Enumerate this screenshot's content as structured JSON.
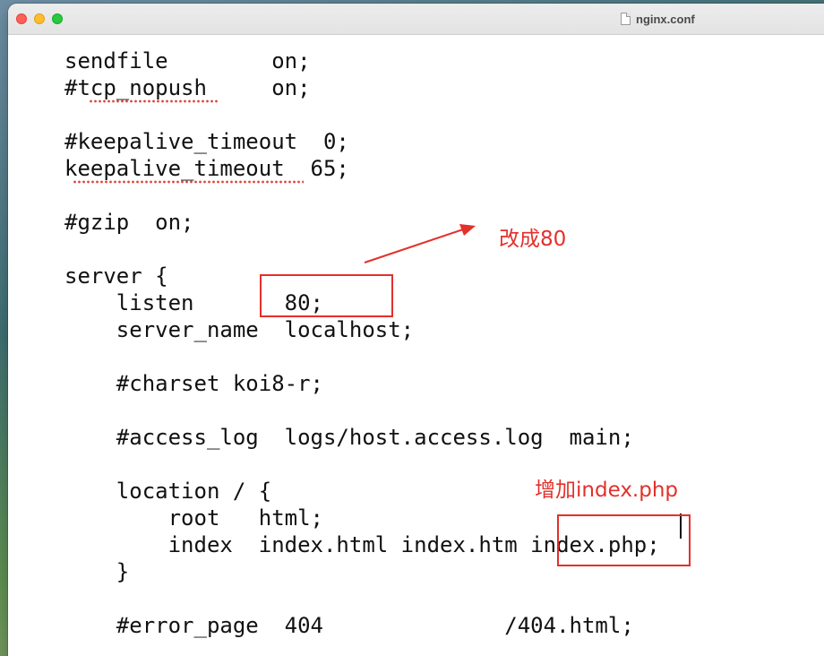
{
  "window": {
    "title": "nginx.conf"
  },
  "editor": {
    "lines": [
      "sendfile        on;",
      "#tcp_nopush     on;",
      "#keepalive_timeout  0;",
      "keepalive_timeout  65;",
      "#gzip  on;",
      "server {",
      "    listen       80;",
      "    server_name  localhost;",
      "    #charset koi8-r;",
      "    #access_log  logs/host.access.log  main;",
      "    location / {",
      "        root   html;",
      "        index  index.html index.htm index.php;",
      "    }",
      "    #error_page  404              /404.html;"
    ]
  },
  "annotations": {
    "listen_note": "改成80",
    "index_note": "增加index.php"
  },
  "colors": {
    "annotation": "#e3302a",
    "spellcheck": "#e0463c"
  }
}
